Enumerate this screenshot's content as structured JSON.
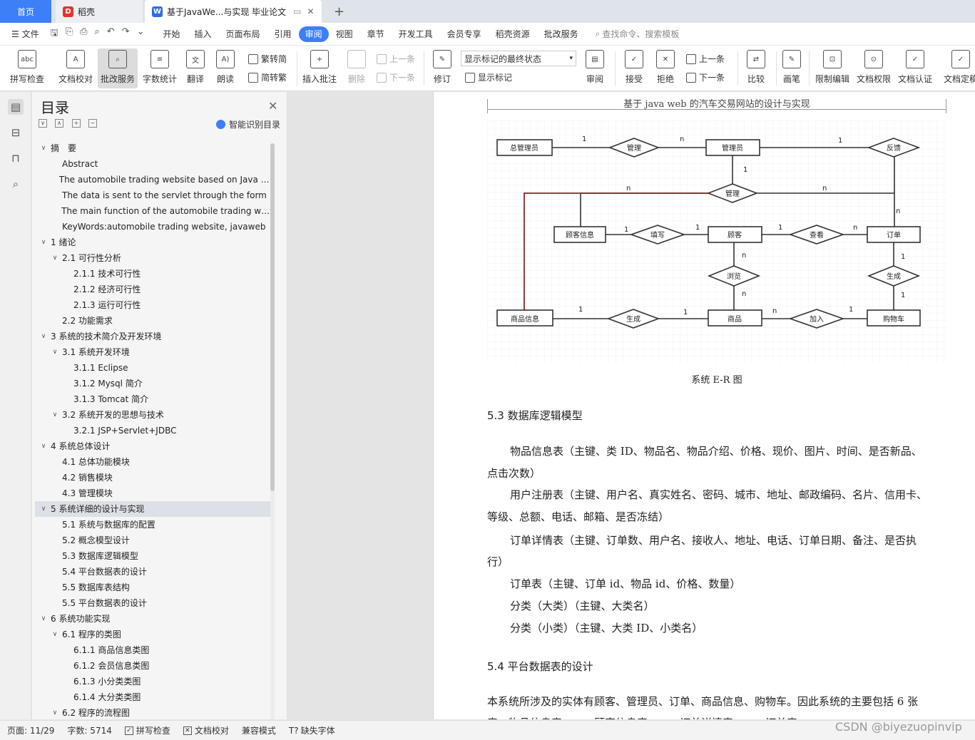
{
  "tabs": {
    "home": "首页",
    "shell": "稻壳",
    "doc": "基于JavaWe...与实现 毕业论文",
    "new_tab": "+"
  },
  "menu": {
    "file": "文件",
    "items": [
      "开始",
      "插入",
      "页面布局",
      "引用",
      "审阅",
      "视图",
      "章节",
      "开发工具",
      "会员专享",
      "稻壳资源",
      "批改服务"
    ],
    "active": "审阅",
    "search_placeholder": "查找命令、搜索模板"
  },
  "ribbon": {
    "spell": "拼写检查",
    "doc_check": "文档校对",
    "correct": "批改服务",
    "word_count": "字数统计",
    "translate": "翻译",
    "read": "朗读",
    "trad": "繁转简",
    "simp": "简转繁",
    "insert_comment": "插入批注",
    "delete": "删除",
    "prev": "上一条",
    "next": "下一条",
    "revise": "修订",
    "markup_state": "显示标记的最终状态",
    "show_markup": "显示标记",
    "review": "审阅",
    "accept": "接受",
    "reject": "拒绝",
    "prev2": "上一条",
    "next2": "下一条",
    "compare": "比较",
    "pen": "画笔",
    "restrict": "限制编辑",
    "permission": "文档权限",
    "certify": "文档认证",
    "finalize": "文档定稿"
  },
  "toc": {
    "title": "目录",
    "smart": "智能识别目录",
    "items": [
      {
        "level": 1,
        "chev": "∨",
        "text": "摘　要"
      },
      {
        "level": 2,
        "chev": "",
        "text": "Abstract"
      },
      {
        "level": 2,
        "chev": "",
        "text": "The automobile trading website based on Java is a platform for vehicle sales"
      },
      {
        "level": 2,
        "chev": "",
        "text": "The data is sent to the servlet through the form"
      },
      {
        "level": 2,
        "chev": "",
        "text": "The main function of the automobile trading website"
      },
      {
        "level": 2,
        "chev": "",
        "text": "KeyWords:automobile trading website, javaweb"
      },
      {
        "level": 1,
        "chev": "∨",
        "text": "1  绪论"
      },
      {
        "level": 2,
        "chev": "∨",
        "text": "2.1 可行性分析"
      },
      {
        "level": 3,
        "chev": "",
        "text": "2.1.1  技术可行性"
      },
      {
        "level": 3,
        "chev": "",
        "text": "2.1.2  经济可行性"
      },
      {
        "level": 3,
        "chev": "",
        "text": "2.1.3  运行可行性"
      },
      {
        "level": 2,
        "chev": "",
        "text": "2.2 功能需求"
      },
      {
        "level": 1,
        "chev": "∨",
        "text": "3  系统的技术简介及开发环境"
      },
      {
        "level": 2,
        "chev": "∨",
        "text": "3.1    系统开发环境"
      },
      {
        "level": 3,
        "chev": "",
        "text": "3.1.1 Eclipse"
      },
      {
        "level": 3,
        "chev": "",
        "text": "3.1.2 Mysql 简介"
      },
      {
        "level": 3,
        "chev": "",
        "text": "3.1.3 Tomcat 简介"
      },
      {
        "level": 2,
        "chev": "∨",
        "text": "3.2 系统开发的思想与技术"
      },
      {
        "level": 3,
        "chev": "",
        "text": "3.2.1 JSP+Servlet+JDBC"
      },
      {
        "level": 1,
        "chev": "∨",
        "text": "4  系统总体设计"
      },
      {
        "level": 2,
        "chev": "",
        "text": "4.1 总体功能模块"
      },
      {
        "level": 2,
        "chev": "",
        "text": "4.2 销售模块"
      },
      {
        "level": 2,
        "chev": "",
        "text": "4.3 管理模块"
      },
      {
        "level": 1,
        "chev": "∨",
        "text": "5  系统详细的设计与实现",
        "selected": true
      },
      {
        "level": 2,
        "chev": "",
        "text": "5.1 系统与数据库的配置"
      },
      {
        "level": 2,
        "chev": "",
        "text": "5.2 概念模型设计"
      },
      {
        "level": 2,
        "chev": "",
        "text": "5.3 数据库逻辑模型"
      },
      {
        "level": 2,
        "chev": "",
        "text": "5.4 平台数据表的设计"
      },
      {
        "level": 2,
        "chev": "",
        "text": "5.5 数据库表结构"
      },
      {
        "level": 2,
        "chev": "",
        "text": "5.5 平台数据表的设计"
      },
      {
        "level": 1,
        "chev": "∨",
        "text": "6  系统功能实现"
      },
      {
        "level": 2,
        "chev": "∨",
        "text": "6.1 程序的类图"
      },
      {
        "level": 3,
        "chev": "",
        "text": "6.1.1 商品信息类图"
      },
      {
        "level": 3,
        "chev": "",
        "text": "6.1.2 会员信息类图"
      },
      {
        "level": 3,
        "chev": "",
        "text": "6.1.3 小分类类图"
      },
      {
        "level": 3,
        "chev": "",
        "text": "6.1.4 大分类类图"
      },
      {
        "level": 2,
        "chev": "∨",
        "text": "6.2 程序的流程图"
      }
    ]
  },
  "document": {
    "header": "基于 java web 的汽车交易网站的设计与实现",
    "diagram_labels": {
      "admin_general": "总管理员",
      "manage1": "管理",
      "admin": "管理员",
      "feedback": "反馈",
      "manage2": "管理",
      "customer_info": "顾客信息",
      "fill": "填写",
      "customer": "顾客",
      "view": "查看",
      "order": "订单",
      "browse": "浏览",
      "generate1": "生成",
      "product_info": "商品信息",
      "generate2": "生成",
      "product": "商品",
      "add": "加入",
      "cart": "购物车"
    },
    "card": {
      "one": "1",
      "n": "n"
    },
    "caption": "系统 E-R 图",
    "section53": "5.3 数据库逻辑模型",
    "para1_l1": "物品信息表（主键、类 ID、物品名、物品介绍、价格、现价、图片、时间、是否新品、",
    "para1_l2": "点击次数）",
    "para2_l1": "用户注册表（主键、用户名、真实姓名、密码、城市、地址、邮政编码、名片、信用卡、",
    "para2_l2": "等级、总额、电话、邮箱、是否冻结）",
    "para3_l1": "订单详情表（主键、订单数、用户名、接收人、地址、电话、订单日期、备注、是否执",
    "para3_l2": "行）",
    "para4": "订单表（主键、订单 id、物品 id、价格、数量）",
    "para5": "分类（大类）（主键、大类名）",
    "para6": "分类（小类）（主键、大类 ID、小类名）",
    "section54": "5.4 平台数据表的设计",
    "para7": "本系统所涉及的实体有顾客、管理员、订单、商品信息、购物车。因此系统的主要包括 6 张",
    "para8": "表，物品信息表、……顾客信息表、……订单详情表、……订单表"
  },
  "status": {
    "page": "页面: 11/29",
    "words": "字数: 5714",
    "spell": "拼写检查",
    "check": "文档校对",
    "compat": "兼容模式",
    "font": "缺失字体"
  },
  "watermark": "CSDN @biyezuopinvip",
  "colors": {
    "accent": "#3d7ff6",
    "page_bg": "#ffffff",
    "canvas_bg": "#d4d4d4",
    "highlight_line": "#8b2a2a"
  }
}
